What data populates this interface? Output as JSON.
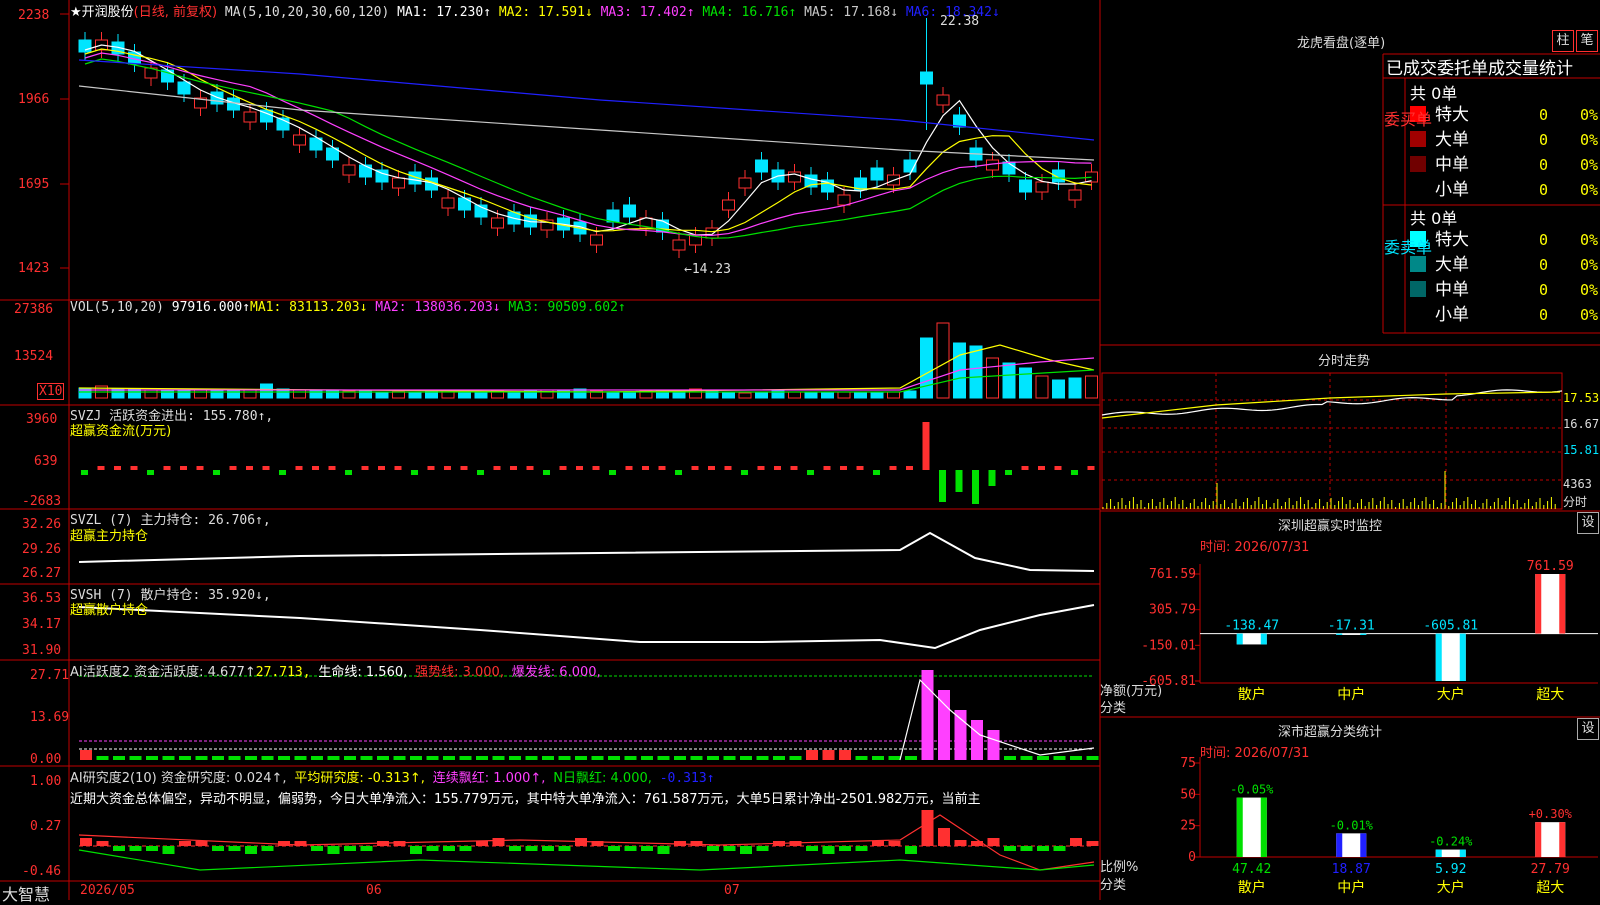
{
  "colors": {
    "up": "#ff3030",
    "down": "#00e5ff",
    "grid": "#c00000",
    "white": "#ffffff",
    "yellow": "#ffff00",
    "magenta": "#ff40ff",
    "green": "#00e000",
    "blue": "#2020ff",
    "gray": "#c8c8c8"
  },
  "main": {
    "title": "★开润股份",
    "mode": "(日线, 前复权)",
    "ma_label": "MA(5,10,20,30,60,120)",
    "ma1": "MA1: 17.230↑",
    "ma2": "MA2: 17.591↓",
    "ma3": "MA3: 17.402↑",
    "ma4": "MA4: 16.716↑",
    "ma5": "MA5: 17.168↓",
    "ma6": "MA6: 18.342↓",
    "hi_label": "22.38",
    "lo_label": "←14.23",
    "axis": [
      "2238",
      "1966",
      "1695",
      "1423"
    ]
  },
  "vol": {
    "label": "VOL(5,10,20)",
    "v": "97916.000↑",
    "ma1": "MA1: 83113.203↓",
    "ma2": "MA2: 138036.203↓",
    "ma3": "MA3: 90509.602↑",
    "axis": [
      "27386",
      "13524"
    ],
    "unit": "X10"
  },
  "svzj": {
    "label": "SVZJ  活跃资金进出: 155.780↑,",
    "sub": "超赢资金流(万元)",
    "axis": [
      "3960",
      "639",
      "-2683"
    ]
  },
  "svzl": {
    "label": "SVZL  (7) 主力持仓: 26.706↑,",
    "sub": "超赢主力持仓",
    "axis": [
      "32.26",
      "29.26",
      "26.27"
    ]
  },
  "svsh": {
    "label": "SVSH  (7) 散户持仓: 35.920↓,",
    "sub": "超赢散户持仓",
    "axis": [
      "36.53",
      "34.17",
      "31.90"
    ]
  },
  "ai1": {
    "label": "AI活跃度2 资金活跃度: 4.677↑",
    "v2": "27.713,",
    "life": "生命线: 1.560,",
    "strong": "强势线: 3.000,",
    "burst": "爆发线: 6.000,",
    "axis": [
      "27.71",
      "13.69",
      "0.00"
    ]
  },
  "ai2": {
    "label": "AI研究度2(10) 资金研究度: 0.024↑,",
    "avg": "平均研究度: -0.313↑,",
    "red": "连续飘红: 1.000↑,",
    "nred": "N日飘红: 4.000,",
    "last": "-0.313↑",
    "text": "近期大资金总体偏空，异动不明显，偏弱势，今日大单净流入：155.779万元，其中特大单净流入：761.587万元，大单5日累计净出-2501.982万元，当前主",
    "axis": [
      "1.00",
      "0.27",
      "-0.46"
    ]
  },
  "xaxis": {
    "brand": "大智慧",
    "d1": "2026/05",
    "d2": "06",
    "d3": "07"
  },
  "lhb": {
    "title": "龙虎看盘(逐单)",
    "btn1": "柱",
    "btn2": "笔",
    "sub": "已成交委托单成交量统计",
    "buy_side": "委买单",
    "sell_side": "委卖单",
    "buy_total": "共 0单",
    "sell_total": "共 0单",
    "buy": [
      {
        "name": "特大",
        "v": "0",
        "p": "0%",
        "c": "#ff0000"
      },
      {
        "name": "大单",
        "v": "0",
        "p": "0%",
        "c": "#a00000"
      },
      {
        "name": "中单",
        "v": "0",
        "p": "0%",
        "c": "#700000"
      },
      {
        "name": "小单",
        "v": "0",
        "p": "0%",
        "c": ""
      }
    ],
    "sell": [
      {
        "name": "特大",
        "v": "0",
        "p": "0%",
        "c": "#00ffff"
      },
      {
        "name": "大单",
        "v": "0",
        "p": "0%",
        "c": "#008888"
      },
      {
        "name": "中单",
        "v": "0",
        "p": "0%",
        "c": "#006666"
      },
      {
        "name": "小单",
        "v": "0",
        "p": "0%",
        "c": ""
      }
    ]
  },
  "fenshi": {
    "title": "分时走势",
    "axis": [
      "17.53",
      "16.67",
      "15.81",
      "4363",
      "分时"
    ]
  },
  "monitor": {
    "title": "深圳超赢实时监控",
    "btn": "设",
    "time": "时间: 2026/07/31",
    "ylabel": "净额(万元)",
    "xlabel": "分类",
    "axis": [
      "761.59",
      "305.79",
      "-150.01",
      "-605.81"
    ]
  },
  "classify": {
    "title": "深市超赢分类统计",
    "btn": "设",
    "time": "时间: 2026/07/31",
    "ylabel": "比例%",
    "xlabel": "分类",
    "axis": [
      "75",
      "50",
      "25",
      "0"
    ]
  },
  "chart_data": [
    {
      "type": "bar",
      "title": "深圳超赢实时监控",
      "ylabel": "净额(万元)",
      "xlabel": "分类",
      "categories": [
        "散户",
        "中户",
        "大户",
        "超大"
      ],
      "values": [
        -138.47,
        -17.31,
        -605.81,
        761.59
      ],
      "ylim": [
        -605.81,
        761.59
      ]
    },
    {
      "type": "bar",
      "title": "深市超赢分类统计",
      "ylabel": "比例%",
      "xlabel": "分类",
      "categories": [
        "散户",
        "中户",
        "大户",
        "超大"
      ],
      "values": [
        47.42,
        18.87,
        5.92,
        27.79
      ],
      "changes": [
        "-0.05%",
        "-0.01%",
        "-0.24%",
        "+0.30%"
      ],
      "ylim": [
        0,
        75
      ]
    }
  ]
}
